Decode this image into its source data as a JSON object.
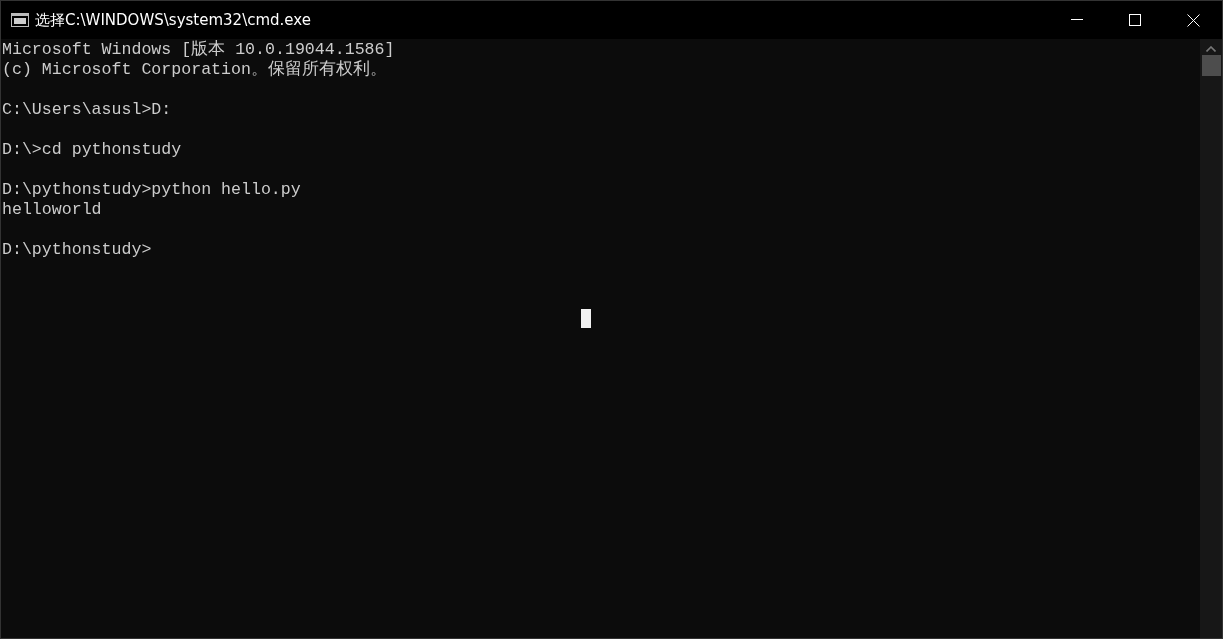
{
  "window": {
    "title": "选择C:\\WINDOWS\\system32\\cmd.exe"
  },
  "console": {
    "blocks": [
      [
        "Microsoft Windows [版本 10.0.19044.1586]",
        "(c) Microsoft Corporation。保留所有权利。"
      ],
      [
        "C:\\Users\\asusl>D:"
      ],
      [
        "D:\\>cd pythonstudy"
      ],
      [
        "D:\\pythonstudy>python hello.py",
        "helloworld"
      ],
      [
        "D:\\pythonstudy>"
      ]
    ]
  }
}
